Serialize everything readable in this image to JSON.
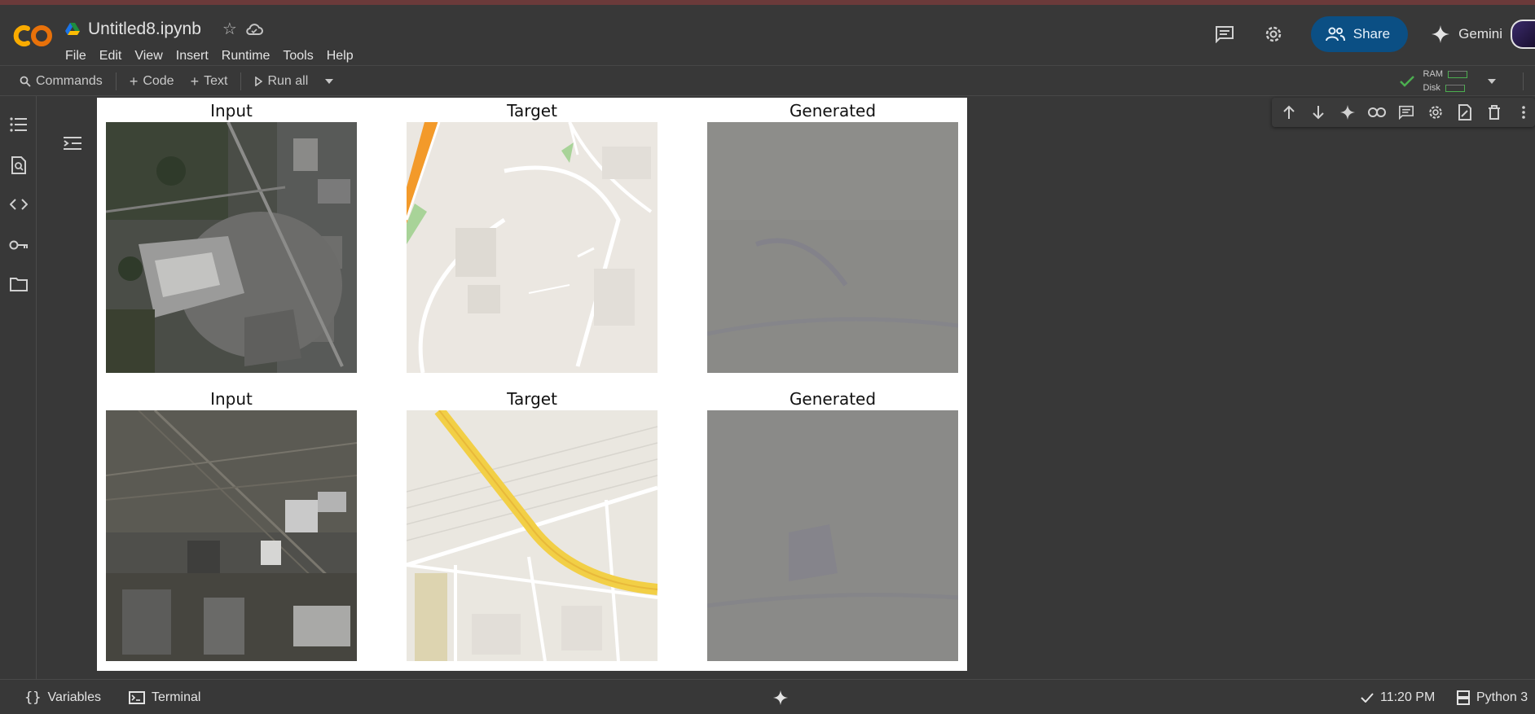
{
  "app": {
    "title": "Untitled8.ipynb"
  },
  "menu": [
    "File",
    "Edit",
    "View",
    "Insert",
    "Runtime",
    "Tools",
    "Help"
  ],
  "header": {
    "share_label": "Share",
    "gemini_label": "Gemini"
  },
  "toolbar": {
    "commands_label": "Commands",
    "code_label": "Code",
    "text_label": "Text",
    "run_all_label": "Run all",
    "ram_label": "RAM",
    "disk_label": "Disk"
  },
  "output": {
    "rows": [
      {
        "titles": [
          "Input",
          "Target",
          "Generated"
        ]
      },
      {
        "titles": [
          "Input",
          "Target",
          "Generated"
        ]
      }
    ]
  },
  "statusbar": {
    "variables_label": "Variables",
    "terminal_label": "Terminal",
    "time": "11:20 PM",
    "kernel_label": "Python 3"
  },
  "colors": {
    "share_bg": "#0b4f84",
    "logo_orange": "#f9ab00",
    "ok_green": "#4caf50",
    "road_yellow": "#f2cf46",
    "road_orange": "#f39a2a"
  }
}
